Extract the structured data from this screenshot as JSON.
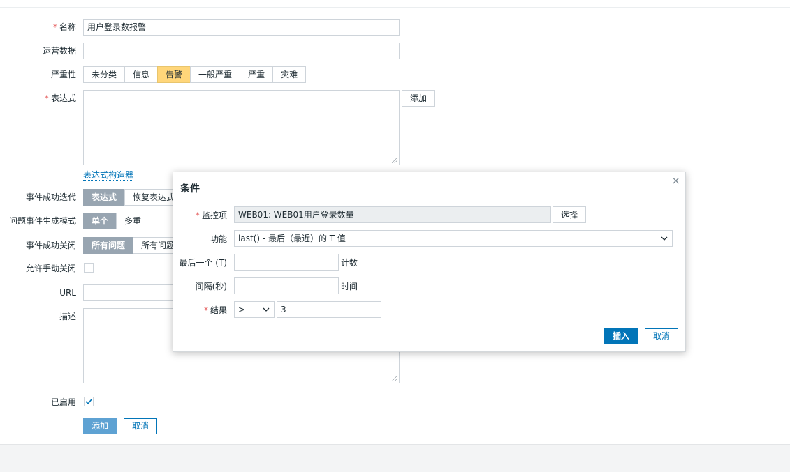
{
  "form": {
    "name_label": "名称",
    "name_value": "用户登录数报警",
    "opdata_label": "运营数据",
    "opdata_value": "",
    "severity_label": "严重性",
    "severity_options": [
      "未分类",
      "信息",
      "告警",
      "一般严重",
      "严重",
      "灾难"
    ],
    "severity_selected": "告警",
    "expression_label": "表达式",
    "expression_value": "",
    "add_expression_btn": "添加",
    "expression_builder_link": "表达式构造器",
    "ok_event_gen_label": "事件成功迭代",
    "ok_event_gen_options": [
      "表达式",
      "恢复表达式"
    ],
    "problem_mode_label": "问题事件生成模式",
    "problem_mode_options": [
      "单个",
      "多重"
    ],
    "ok_close_label": "事件成功关闭",
    "ok_close_options": [
      "所有问题",
      "所有问题"
    ],
    "manual_close_label": "允许手动关闭",
    "url_label": "URL",
    "url_value": "",
    "description_label": "描述",
    "enabled_label": "已启用",
    "submit_btn": "添加",
    "cancel_btn": "取消"
  },
  "dialog": {
    "title": "条件",
    "close_symbol": "×",
    "item_label": "监控项",
    "item_value": "WEB01: WEB01用户登录数量",
    "select_btn": "选择",
    "function_label": "功能",
    "function_value": "last() - 最后（最近）的 T 值",
    "last_label": "最后一个 (T)",
    "last_value": "",
    "last_unit": "计数",
    "interval_label": "间隔(秒)",
    "interval_value": "",
    "interval_unit": "时间",
    "result_label": "结果",
    "result_operator": ">",
    "result_value": "3",
    "insert_btn": "插入",
    "cancel_btn": "取消"
  },
  "colors": {
    "primary": "#0275b8",
    "severity_warning": "#ffd67a",
    "segment_selected": "#98a5b1",
    "required": "#e45959"
  },
  "icons": {
    "checkmark": "check-icon",
    "chevron": "chevron-down-icon",
    "close": "close-icon"
  }
}
